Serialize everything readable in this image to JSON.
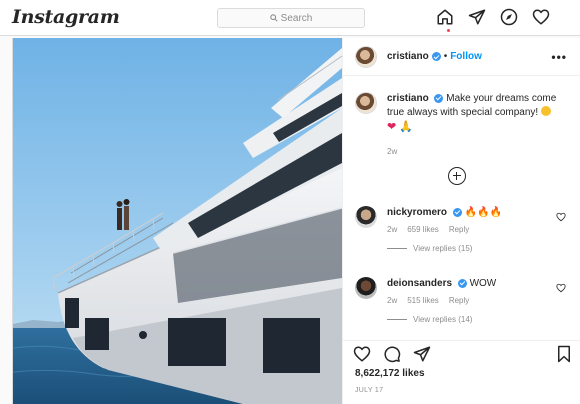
{
  "nav": {
    "logo": "Instagram",
    "search_placeholder": "Search",
    "icons": [
      "home-icon",
      "direct-icon",
      "explore-icon",
      "activity-icon"
    ]
  },
  "post": {
    "author": "cristiano",
    "separator": "•",
    "follow_label": "Follow",
    "more_label": "•••",
    "caption": {
      "username": "cristiano",
      "text": "Make your dreams come true always with special company!",
      "time": "2w"
    },
    "comments": [
      {
        "username": "nickyromero",
        "text": "🔥🔥🔥",
        "time": "2w",
        "likes": "659 likes",
        "reply": "Reply",
        "view_replies": "View replies (15)"
      },
      {
        "username": "deionsanders",
        "text": "WOW",
        "time": "2w",
        "likes": "515 likes",
        "reply": "Reply",
        "view_replies": "View replies (14)"
      }
    ],
    "likes_count": "8,622,172 likes",
    "date": "JULY 17"
  },
  "colors": {
    "accent": "#0095f6",
    "verified": "#3897f0",
    "border": "#dbdbdb",
    "muted": "#8e8e8e"
  }
}
